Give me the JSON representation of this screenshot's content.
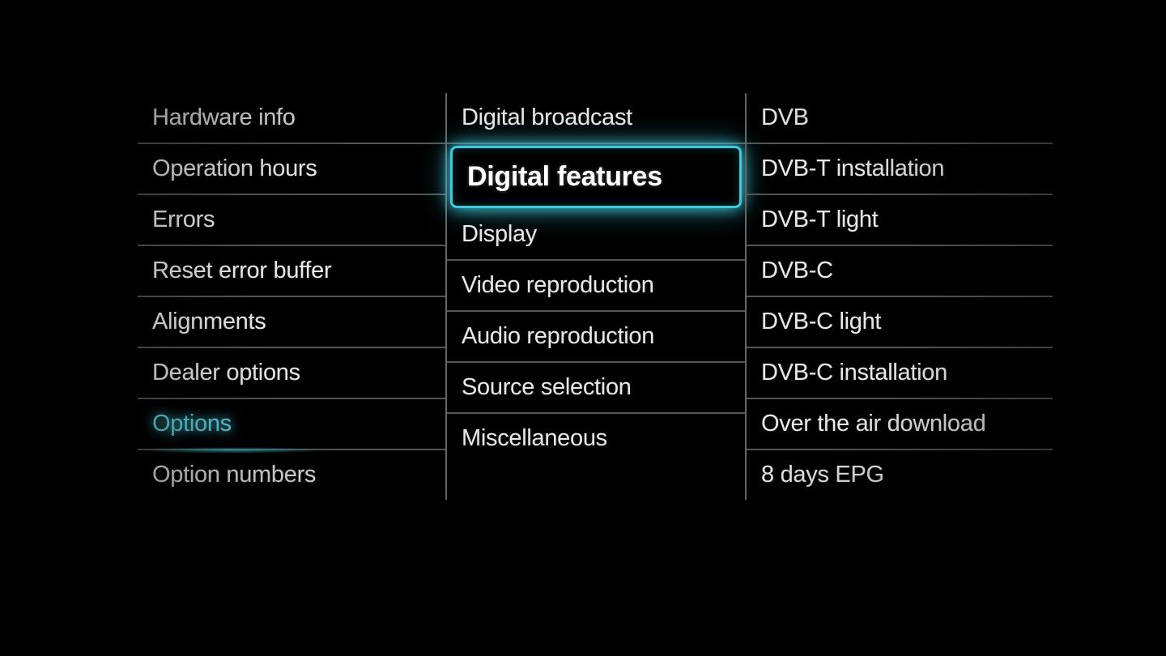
{
  "menu": {
    "column1": {
      "items": [
        {
          "label": "Hardware info",
          "state": "normal"
        },
        {
          "label": "Operation hours",
          "state": "normal"
        },
        {
          "label": "Errors",
          "state": "normal"
        },
        {
          "label": "Reset error buffer",
          "state": "normal"
        },
        {
          "label": "Alignments",
          "state": "normal"
        },
        {
          "label": "Dealer options",
          "state": "normal"
        },
        {
          "label": "Options",
          "state": "path-selected"
        },
        {
          "label": "Option numbers",
          "state": "normal"
        }
      ]
    },
    "column2": {
      "items": [
        {
          "label": "Digital broadcast",
          "state": "normal"
        },
        {
          "label": "Digital features",
          "state": "highlighted"
        },
        {
          "label": "Display",
          "state": "normal"
        },
        {
          "label": "Video reproduction",
          "state": "normal"
        },
        {
          "label": "Audio reproduction",
          "state": "normal"
        },
        {
          "label": "Source selection",
          "state": "normal"
        },
        {
          "label": "Miscellaneous",
          "state": "normal"
        }
      ]
    },
    "column3": {
      "items": [
        {
          "label": "DVB",
          "state": "normal"
        },
        {
          "label": "DVB-T installation",
          "state": "normal"
        },
        {
          "label": "DVB-T light",
          "state": "normal"
        },
        {
          "label": "DVB-C",
          "state": "normal"
        },
        {
          "label": "DVB-C light",
          "state": "normal"
        },
        {
          "label": "DVB-C installation",
          "state": "normal"
        },
        {
          "label": "Over the air download",
          "state": "normal"
        },
        {
          "label": "8 days EPG",
          "state": "normal"
        }
      ]
    }
  }
}
